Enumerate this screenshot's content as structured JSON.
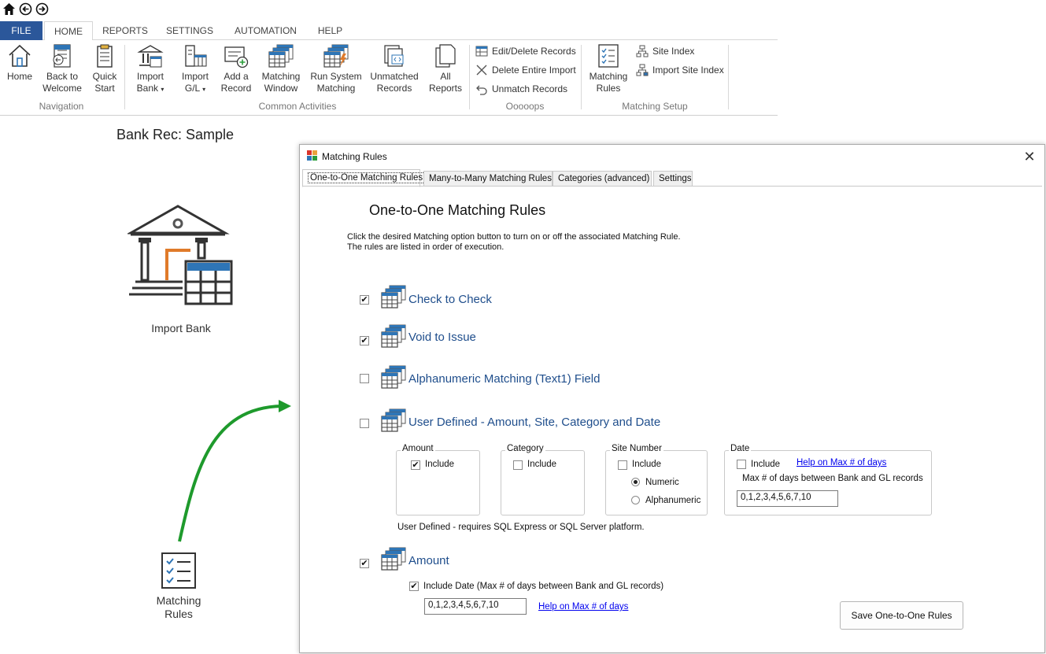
{
  "quick_access": {
    "icons": [
      "home-icon",
      "back-arrow-icon",
      "forward-arrow-icon"
    ]
  },
  "menu": {
    "tabs": [
      "FILE",
      "HOME",
      "REPORTS",
      "SETTINGS",
      "AUTOMATION",
      "HELP"
    ]
  },
  "ribbon": {
    "navigation": {
      "group_label": "Navigation",
      "home": [
        "Home"
      ],
      "back": [
        "Back to",
        "Welcome"
      ],
      "quick": [
        "Quick",
        "Start"
      ]
    },
    "common": {
      "group_label": "Common Activities",
      "import_bank": [
        "Import",
        "Bank"
      ],
      "import_gl": [
        "Import",
        "G/L"
      ],
      "add_record": [
        "Add a",
        "Record"
      ],
      "matching_window": [
        "Matching",
        "Window"
      ],
      "run_system": [
        "Run System",
        "Matching"
      ],
      "unmatched": [
        "Unmatched",
        "Records"
      ],
      "all_reports": [
        "All",
        "Reports"
      ]
    },
    "ooops": {
      "group_label": "Ooooops",
      "edit_delete": "Edit/Delete Records",
      "delete_import": "Delete Entire Import",
      "unmatch": "Unmatch Records"
    },
    "matching_setup": {
      "group_label": "Matching Setup",
      "matching_rules": [
        "Matching",
        "Rules"
      ],
      "site_index": "Site Index",
      "import_site_index": "Import Site Index"
    }
  },
  "left": {
    "title": "Bank Rec: Sample",
    "import_bank_label": "Import Bank",
    "matching_rules_label": [
      "Matching",
      "Rules"
    ]
  },
  "dialog": {
    "title": "Matching Rules",
    "close": "✕",
    "tabs": [
      "One-to-One Matching Rules",
      "Many-to-Many Matching Rules",
      "Categories (advanced)",
      "Settings"
    ],
    "heading": "One-to-One Matching Rules",
    "description": [
      "Click the desired Matching option button to turn on or off the associated Matching Rule.",
      "The rules are listed in order of execution."
    ],
    "rules": {
      "check_to_check": {
        "label": "Check to Check",
        "checked": true
      },
      "void_to_issue": {
        "label": "Void to Issue",
        "checked": true
      },
      "alphanumeric": {
        "label": "Alphanumeric Matching (Text1) Field",
        "checked": false
      },
      "user_defined": {
        "label": "User Defined - Amount, Site, Category and Date",
        "checked": false
      },
      "amount": {
        "label": "Amount",
        "checked": true
      }
    },
    "user_defined": {
      "amount": {
        "title": "Amount",
        "include": "Include",
        "checked": true
      },
      "category": {
        "title": "Category",
        "include": "Include",
        "checked": false
      },
      "site_number": {
        "title": "Site Number",
        "include": "Include",
        "checked": false,
        "numeric": "Numeric",
        "alphanumeric": "Alphanumeric",
        "selected": "Numeric"
      },
      "date": {
        "title": "Date",
        "include": "Include",
        "checked": false,
        "help_link": "Help on Max # of days",
        "max_label": "Max # of days between Bank and GL records",
        "value": "0,1,2,3,4,5,6,7,10"
      },
      "note": "User Defined - requires SQL Express or SQL Server platform."
    },
    "amount_rule": {
      "include_date": "Include Date (Max # of days between Bank and GL records)",
      "include_date_checked": true,
      "days_value": "0,1,2,3,4,5,6,7,10",
      "help_link": "Help on Max # of days"
    },
    "save_button": "Save One-to-One Rules"
  },
  "colors": {
    "file_tab": "#2b579a",
    "rule_label": "#1f4e8c",
    "arrow": "#1e9a2c",
    "accent_orange": "#e07b2a",
    "accent_blue": "#2e75b6"
  }
}
